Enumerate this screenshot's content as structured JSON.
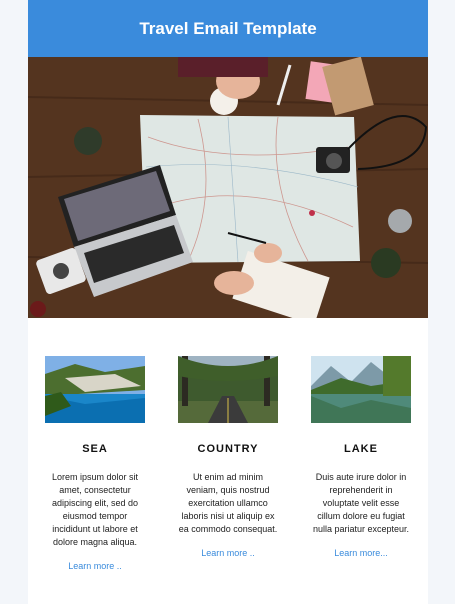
{
  "header": {
    "title": "Travel Email Template"
  },
  "colors": {
    "header_bg": "#3a8bdc",
    "link": "#3a8bdc"
  },
  "hero": {
    "image": "travel-planning-map-photo"
  },
  "columns": [
    {
      "image": "sea-cove-photo",
      "heading": "SEA",
      "body": "Lorem ipsum dolor sit amet, consectetur adipiscing elit, sed do eiusmod tempor incididunt ut labore et dolore magna aliqua.",
      "link": "Learn more .."
    },
    {
      "image": "country-road-photo",
      "heading": "COUNTRY",
      "body": "Ut enim ad minim veniam, quis nostrud exercitation ullamco laboris nisi ut aliquip ex ea commodo consequat.",
      "link": "Learn more .."
    },
    {
      "image": "mountain-lake-photo",
      "heading": "LAKE",
      "body": "Duis aute irure dolor in reprehenderit in voluptate velit esse cillum dolore eu fugiat nulla pariatur excepteur.",
      "link": "Learn more..."
    }
  ]
}
